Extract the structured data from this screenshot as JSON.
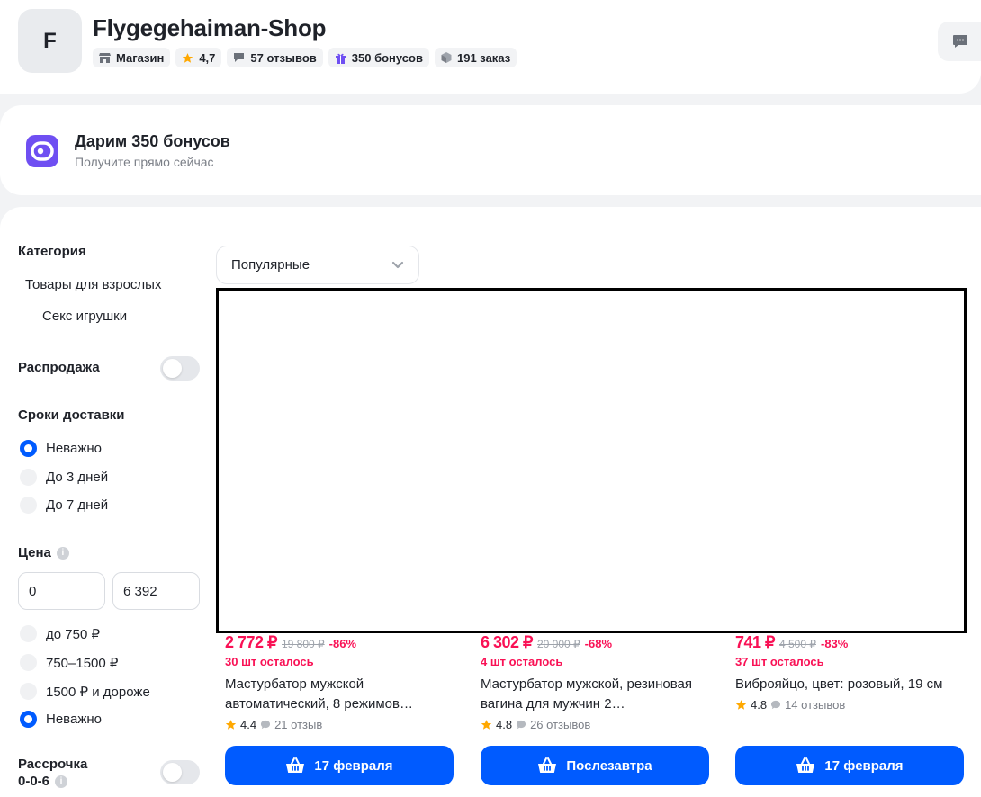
{
  "shop": {
    "logo_letter": "F",
    "name": "Flygegehaiman-Shop",
    "chips": {
      "type": "Магазин",
      "rating": "4,7",
      "reviews": "57 отзывов",
      "bonuses": "350 бонусов",
      "orders": "191 заказ"
    }
  },
  "bonus": {
    "title": "Дарим 350 бонусов",
    "subtitle": "Получите прямо сейчас"
  },
  "filters": {
    "category_title": "Категория",
    "category_items": [
      "Товары для взрослых",
      "Секс игрушки"
    ],
    "sale_label": "Распродажа",
    "delivery_title": "Сроки доставки",
    "delivery_options": [
      "Неважно",
      "До 3 дней",
      "До 7 дней"
    ],
    "price_title": "Цена",
    "price_from": "0",
    "price_to": "6 392",
    "price_options": [
      "до 750 ₽",
      "750–1500 ₽",
      "1500 ₽ и дороже",
      "Неважно"
    ],
    "installment_line1": "Рассрочка",
    "installment_line2": "0-0-6"
  },
  "sort": {
    "selected": "Популярные"
  },
  "products": [
    {
      "price": "2 772 ₽",
      "old_price": "19 800 ₽",
      "discount": "-86%",
      "stock": "30 шт осталось",
      "name": "Мастурбатор мужской автоматический, 8 режимов…",
      "rating": "4.4",
      "reviews": "21 отзыв",
      "button": "17 февраля"
    },
    {
      "price": "6 302 ₽",
      "old_price": "20 000 ₽",
      "discount": "-68%",
      "stock": "4 шт осталось",
      "name": "Мастурбатор мужской, резиновая вагина для мужчин 2…",
      "rating": "4.8",
      "reviews": "26 отзывов",
      "button": "Послезавтра"
    },
    {
      "price": "741 ₽",
      "old_price": "4 500 ₽",
      "discount": "-83%",
      "stock": "37 шт осталось",
      "name": "Виброяйцо, цвет: розовый, 19 см",
      "rating": "4.8",
      "reviews": "14 отзывов",
      "button": "17 февраля"
    }
  ],
  "colors": {
    "accent": "#005bff",
    "price": "#f91155",
    "star": "#ffa800",
    "bonus_icon": "#6f4ff2"
  }
}
